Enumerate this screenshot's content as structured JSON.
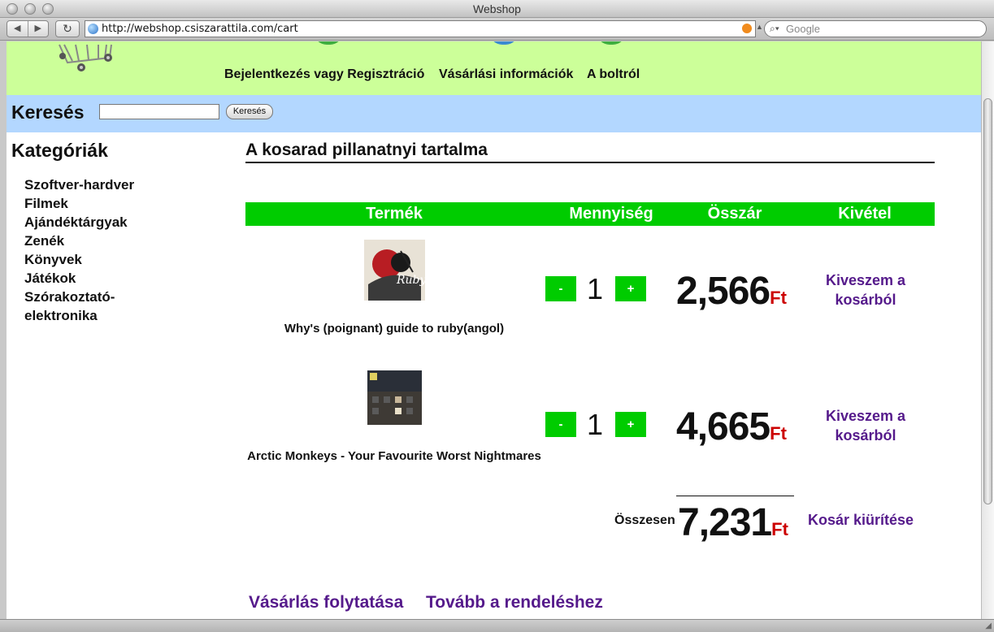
{
  "browser": {
    "window_title": "Webshop",
    "url": "http://webshop.csiszarattila.com/cart",
    "search_placeholder": "Google"
  },
  "header": {
    "nav": [
      "Bejelentkezés vagy Regisztráció",
      "Vásárlási információk",
      "A boltról"
    ]
  },
  "search": {
    "label": "Keresés",
    "button": "Keresés",
    "value": ""
  },
  "sidebar": {
    "title": "Kategóriák",
    "items": [
      "Szoftver-hardver",
      "Filmek",
      "Ajándéktárgyak",
      "Zenék",
      "Könyvek",
      "Játékok",
      "Szórakoztató-elektronika"
    ]
  },
  "cart": {
    "title": "A kosarad pillanatnyi tartalma",
    "columns": [
      "Termék",
      "Mennyiség",
      "Összár",
      "Kivétel"
    ],
    "items": [
      {
        "name": "Why's (poignant) guide to ruby(angol)",
        "quantity": "1",
        "price": "2,566",
        "remove": "Kiveszem a kosárból"
      },
      {
        "name": "Arctic Monkeys - Your Favourite Worst Nightmares",
        "quantity": "1",
        "price": "4,665",
        "remove": "Kiveszem a kosárból"
      }
    ],
    "minus_label": "-",
    "plus_label": "+",
    "currency": "Ft",
    "total_label": "Összesen",
    "total": "7,231",
    "empty_cart": "Kosár kiürítése",
    "continue_shopping": "Vásárlás folytatása",
    "checkout": "Tovább a rendeléshez"
  },
  "colors": {
    "header_bg": "#ccff99",
    "search_bg": "#b3d7ff",
    "table_header_bg": "#00cc00",
    "link": "#551a8b",
    "currency": "#cc0000"
  }
}
